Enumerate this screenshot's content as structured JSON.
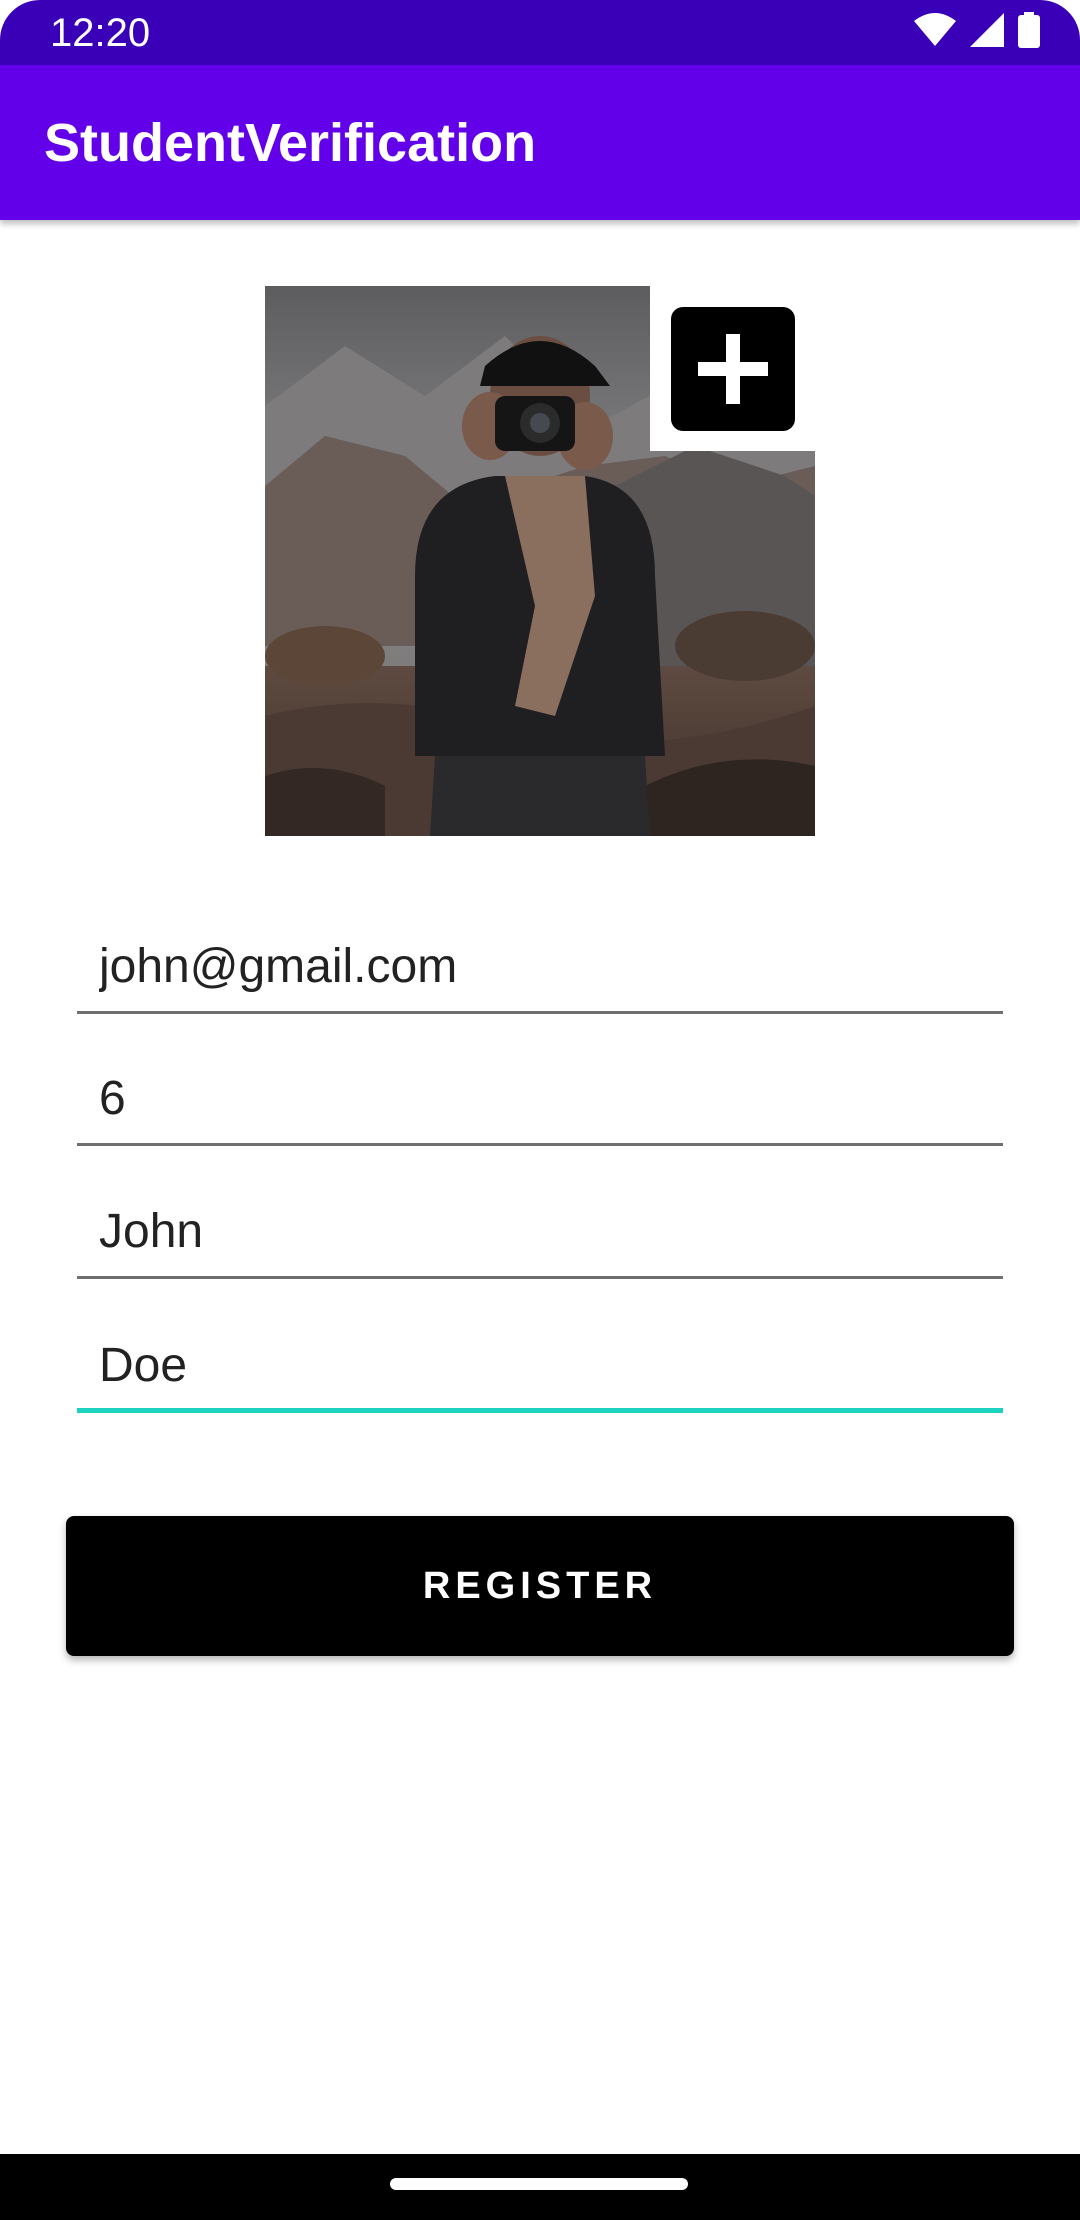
{
  "status_bar": {
    "time": "12:20",
    "icons": [
      "wifi-icon",
      "signal-icon",
      "battery-icon"
    ],
    "background": "#3a00b8"
  },
  "app_bar": {
    "title": "StudentVerification",
    "background": "#6200ea"
  },
  "profile_photo": {
    "description_icon": "photo",
    "add_button_icon": "plus-icon"
  },
  "form": {
    "email": {
      "value": "john@gmail.com",
      "placeholder": ""
    },
    "number": {
      "value": "6",
      "placeholder": ""
    },
    "first_name": {
      "value": "John",
      "placeholder": ""
    },
    "last_name": {
      "value": "Doe",
      "placeholder": ""
    },
    "focused_field": "last_name",
    "accent_color": "#1ed2c0"
  },
  "register_button": {
    "label": "REGISTER"
  },
  "nav_bar": {
    "handle": "home-handle"
  }
}
